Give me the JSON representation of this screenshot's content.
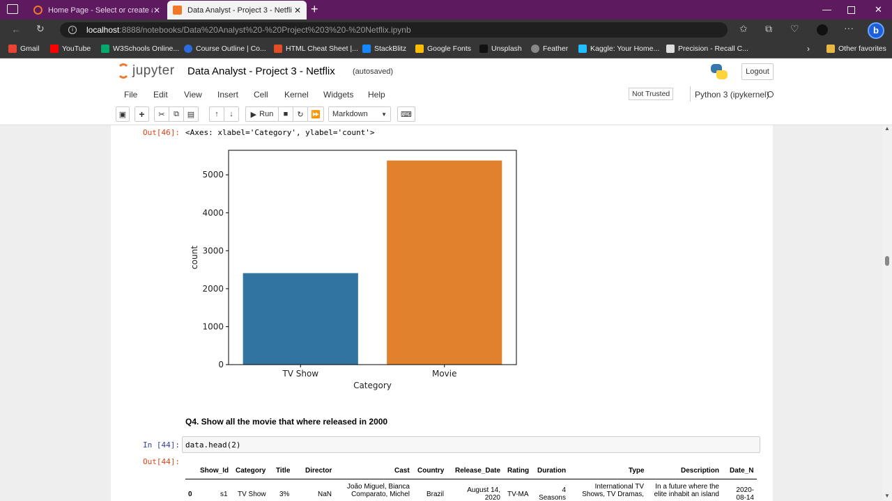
{
  "browser": {
    "tabs": [
      {
        "title": "Home Page - Select or create a n"
      },
      {
        "title": "Data Analyst - Project 3 - Netflix"
      }
    ],
    "url_host": "localhost",
    "url_rest": ":8888/notebooks/Data%20Analyst%20-%20Project%203%20-%20Netflix.ipynb",
    "bookmarks": [
      {
        "label": "Gmail",
        "color": "#ea4335"
      },
      {
        "label": "YouTube",
        "color": "#ff0000"
      },
      {
        "label": "W3Schools Online...",
        "color": "#04aa6d"
      },
      {
        "label": "Course Outline | Co...",
        "color": "#2d6cdf"
      },
      {
        "label": "HTML Cheat Sheet |...",
        "color": "#e44d26"
      },
      {
        "label": "StackBlitz",
        "color": "#1389fd"
      },
      {
        "label": "Google Fonts",
        "color": "#fbbc04"
      },
      {
        "label": "Unsplash",
        "color": "#111111"
      },
      {
        "label": "Feather",
        "color": "#888888"
      },
      {
        "label": "Kaggle: Your Home...",
        "color": "#20beff"
      },
      {
        "label": "Precision - Recall C...",
        "color": "#dddddd"
      }
    ],
    "other_favorites": "Other favorites"
  },
  "jupyter": {
    "logo_text": "jupyter",
    "notebook_title": "Data Analyst - Project 3 - Netflix",
    "autosave": "(autosaved)",
    "logout": "Logout",
    "menus": [
      "File",
      "Edit",
      "View",
      "Insert",
      "Cell",
      "Kernel",
      "Widgets",
      "Help"
    ],
    "trust": "Not Trusted",
    "kernel": "Python 3 (ipykernel)",
    "run_label": "Run",
    "cell_type": "Markdown"
  },
  "cells": {
    "out46_prompt": "Out[46]:",
    "out46_text": "<Axes: xlabel='Category', ylabel='count'>",
    "markdown_q4": "Q4. Show all the movie that where released in 2000",
    "in44_prompt": "In [44]:",
    "in44_code": "data.head(2)",
    "out44_prompt": "Out[44]:"
  },
  "chart_data": {
    "type": "bar",
    "categories": [
      "TV Show",
      "Movie"
    ],
    "values": [
      2410,
      5377
    ],
    "colors": [
      "#3274a1",
      "#e1812c"
    ],
    "xlabel": "Category",
    "ylabel": "count",
    "yticks": [
      0,
      1000,
      2000,
      3000,
      4000,
      5000
    ],
    "ylim": [
      0,
      5646
    ]
  },
  "table": {
    "columns": [
      "Show_Id",
      "Category",
      "Title",
      "Director",
      "Cast",
      "Country",
      "Release_Date",
      "Rating",
      "Duration",
      "Type",
      "Description",
      "Date_N"
    ],
    "row0": {
      "index": "0",
      "show_id": "s1",
      "category": "TV Show",
      "title": "3%",
      "director": "NaN",
      "cast": "João Miguel, Bianca Comparato, Michel",
      "country": "Brazil",
      "release_date": "August 14, 2020",
      "rating": "TV-MA",
      "duration": "4 Seasons",
      "type": "International TV Shows, TV Dramas,",
      "description": "In a future where the elite inhabit an island",
      "date_n": "2020-08-14"
    }
  }
}
